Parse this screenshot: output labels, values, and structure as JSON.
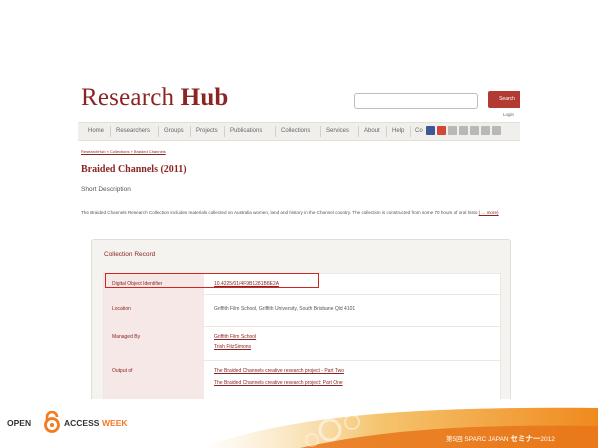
{
  "site": {
    "logo_regular": "Research ",
    "logo_bold": "Hub",
    "search_button": "Search",
    "login": "Login"
  },
  "nav": {
    "items": [
      "Home",
      "Researchers",
      "Groups",
      "Projects",
      "Publications",
      "Collections",
      "Services",
      "About",
      "Help",
      "Co"
    ]
  },
  "breadcrumb": "ResearchHub » Collections » Braided Channels",
  "page": {
    "title": "Braided Channels (2011)",
    "section": "Short Description",
    "description": "The Braided Channels Research Collection includes materials collected on Australia women, land and history in the Channel country. The collection is constructed from some 70 hours of oral histo",
    "more": "( ... more)"
  },
  "record": {
    "title": "Collection Record",
    "rows": [
      {
        "label": "Digital Object Identifier",
        "values": [
          "10.4225/01/4F9B1281B8E2A"
        ]
      },
      {
        "label": "Location",
        "values": [
          "Griffith Film School, Griffith University, South Brisbane Qld 4101"
        ]
      },
      {
        "label": "Managed By",
        "values": [
          "Griffith Film School",
          "Trish FitzSimons"
        ]
      },
      {
        "label": "Output of",
        "values": [
          "The Braided Channels creative research project - Part Two",
          "The Braided Channels creative research project: Part One"
        ]
      }
    ]
  },
  "footer": {
    "open": "OPEN",
    "access": "ACCESS",
    "week": "WEEK",
    "seminar_prefix": "第5回 SPARC JAPAN ",
    "seminar_bold": "セミナー",
    "seminar_year": "2012"
  },
  "colors": {
    "brand": "#8a2524",
    "highlight": "#d42323",
    "oa_orange": "#f47a20"
  }
}
